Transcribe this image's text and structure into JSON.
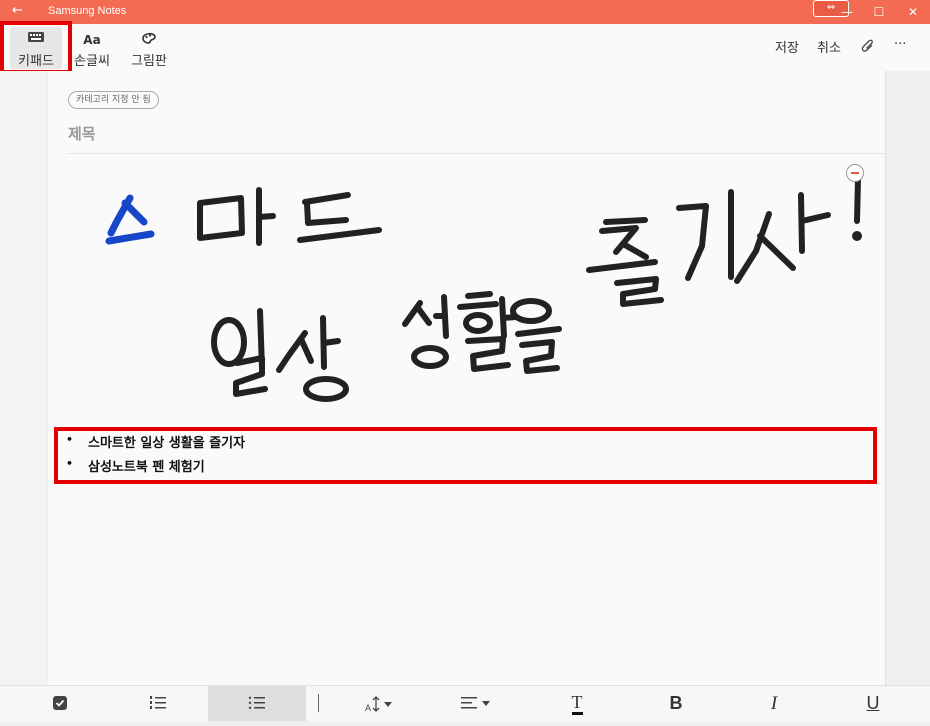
{
  "window": {
    "title": "Samsung Notes",
    "back_glyph": "←",
    "minimize_glyph": "—",
    "maximize_glyph": "☐",
    "close_glyph": "✕",
    "restore_glyph": "⇔"
  },
  "toolbar": {
    "modes": [
      {
        "label": "키패드",
        "icon": "keyboard-icon",
        "active": true
      },
      {
        "label": "손글씨",
        "icon": "handwriting-icon",
        "glyph": "Aa"
      },
      {
        "label": "그림판",
        "icon": "palette-icon"
      }
    ],
    "save_label": "저장",
    "cancel_label": "취소",
    "more_glyph": "···"
  },
  "note": {
    "category_label": "카테고리 지정 안 됨",
    "title_placeholder": "제목",
    "handwriting_lines": [
      "스마트",
      "일상 생활을 즐기자!"
    ],
    "list_items": [
      "스마트한 일상 생활을 즐기자",
      "삼성노트북 펜 체험기"
    ],
    "bullet_glyph": "•"
  },
  "bottom_toolbar": {
    "items": [
      {
        "icon": "checkbox-icon"
      },
      {
        "icon": "numbered-list-icon"
      },
      {
        "icon": "bullet-list-icon",
        "active": true
      },
      {
        "icon": "font-size-icon"
      },
      {
        "icon": "align-icon"
      },
      {
        "icon": "text-color-icon",
        "glyph": "T"
      },
      {
        "icon": "bold-icon",
        "glyph": "B"
      },
      {
        "icon": "italic-icon",
        "glyph": "I"
      },
      {
        "icon": "underline-icon",
        "glyph": "U"
      }
    ],
    "dropdown_glyph": "▾"
  },
  "colors": {
    "titlebar": "#f36b52",
    "highlight": "#e40000",
    "ink_blue": "#1746c8",
    "ink_black": "#222222"
  }
}
